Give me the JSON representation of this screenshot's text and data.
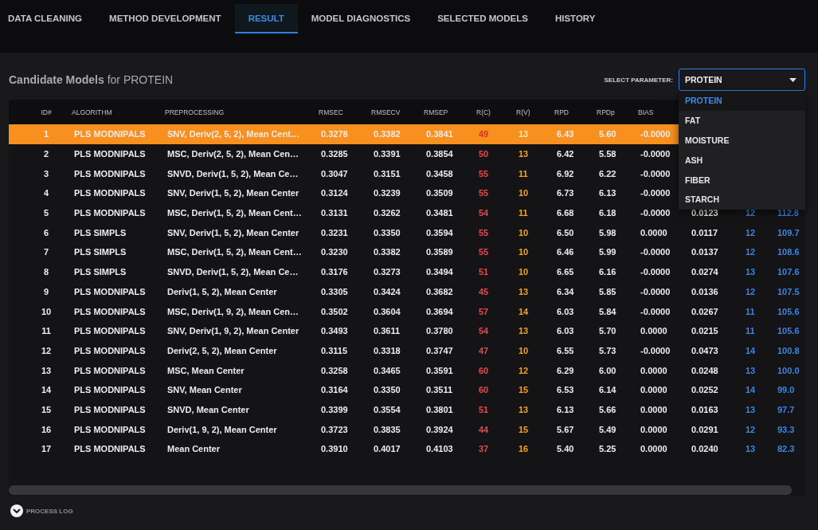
{
  "tabs": [
    {
      "label": "DATA CLEANING",
      "selected": false
    },
    {
      "label": "METHOD DEVELOPMENT",
      "selected": false
    },
    {
      "label": "RESULT",
      "selected": true
    },
    {
      "label": "MODEL DIAGNOSTICS",
      "selected": false
    },
    {
      "label": "SELECTED MODELS",
      "selected": false
    },
    {
      "label": "HISTORY",
      "selected": false
    }
  ],
  "heading": "**Candidate Models** for PROTEIN",
  "parameter_select": {
    "label": "SELECT PARAMETER:",
    "value": "PROTEIN",
    "expanded": true,
    "options": [
      {
        "label": "PROTEIN",
        "selected": true
      },
      {
        "label": "FAT",
        "selected": false
      },
      {
        "label": "MOISTURE",
        "selected": false
      },
      {
        "label": "ASH",
        "selected": false
      },
      {
        "label": "FIBER",
        "selected": false
      },
      {
        "label": "STARCH",
        "selected": false
      }
    ]
  },
  "table": {
    "columns": [
      {
        "label": "ID#",
        "kind": "index"
      },
      {
        "label": "ALGORITHM",
        "kind": "text"
      },
      {
        "label": "PREPROCESSING",
        "kind": "text"
      },
      {
        "label": "RMSEC",
        "kind": "number"
      },
      {
        "label": "RMSECV",
        "kind": "number"
      },
      {
        "label": "RMSEP",
        "kind": "number"
      },
      {
        "label": "R(C)",
        "kind": "alert"
      },
      {
        "label": "R(V)",
        "kind": "warning"
      },
      {
        "label": "RPD",
        "kind": "number"
      },
      {
        "label": "RPDp",
        "kind": "number"
      },
      {
        "label": "BIAS",
        "kind": "number"
      },
      {
        "kind": "number"
      },
      {
        "kind": "accent"
      },
      {
        "kind": "accent"
      }
    ],
    "rows": [
      {
        "selected": true,
        "cells": [
          "1",
          "PLS MODNIPALS",
          "SNV, Deriv(2, 5, 2), Mean Cent…",
          "0.3278",
          "0.3382",
          "0.3841",
          "49",
          "13",
          "6.43",
          "5.60",
          "-0.0000"
        ]
      },
      {
        "selected": false,
        "cells": [
          "2",
          "PLS MODNIPALS",
          "MSC, Deriv(2, 5, 2), Mean Cen…",
          "0.3285",
          "0.3391",
          "0.3854",
          "50",
          "13",
          "6.42",
          "5.58",
          "-0.0000"
        ]
      },
      {
        "selected": false,
        "cells": [
          "3",
          "PLS MODNIPALS",
          "SNVD, Deriv(1, 5, 2), Mean Ce…",
          "0.3047",
          "0.3151",
          "0.3458",
          "55",
          "11",
          "6.92",
          "6.22",
          "-0.0000"
        ]
      },
      {
        "selected": false,
        "cells": [
          "4",
          "PLS MODNIPALS",
          "SNV, Deriv(1, 5, 2), Mean Center",
          "0.3124",
          "0.3239",
          "0.3509",
          "55",
          "10",
          "6.73",
          "6.13",
          "-0.0000"
        ]
      },
      {
        "selected": false,
        "cells": [
          "5",
          "PLS MODNIPALS",
          "MSC, Deriv(1, 5, 2), Mean Cent…",
          "0.3131",
          "0.3262",
          "0.3481",
          "54",
          "11",
          "6.68",
          "6.18",
          "-0.0000",
          "0.0123",
          "12",
          "112.8"
        ]
      },
      {
        "selected": false,
        "cells": [
          "6",
          "PLS SIMPLS",
          "SNV, Deriv(1, 5, 2), Mean Center",
          "0.3231",
          "0.3350",
          "0.3594",
          "55",
          "10",
          "6.50",
          "5.98",
          "0.0000",
          "0.0117",
          "12",
          "109.7"
        ]
      },
      {
        "selected": false,
        "cells": [
          "7",
          "PLS SIMPLS",
          "MSC, Deriv(1, 5, 2), Mean Cent…",
          "0.3230",
          "0.3382",
          "0.3589",
          "55",
          "10",
          "6.46",
          "5.99",
          "-0.0000",
          "0.0137",
          "12",
          "108.6"
        ]
      },
      {
        "selected": false,
        "cells": [
          "8",
          "PLS SIMPLS",
          "SNVD, Deriv(1, 5, 2), Mean Ce…",
          "0.3176",
          "0.3273",
          "0.3494",
          "51",
          "10",
          "6.65",
          "6.16",
          "-0.0000",
          "0.0274",
          "13",
          "107.6"
        ]
      },
      {
        "selected": false,
        "cells": [
          "9",
          "PLS MODNIPALS",
          "Deriv(1, 5, 2), Mean Center",
          "0.3305",
          "0.3424",
          "0.3682",
          "45",
          "13",
          "6.34",
          "5.85",
          "-0.0000",
          "0.0136",
          "12",
          "107.5"
        ]
      },
      {
        "selected": false,
        "cells": [
          "10",
          "PLS MODNIPALS",
          "MSC, Deriv(1, 9, 2), Mean Cen…",
          "0.3502",
          "0.3604",
          "0.3694",
          "57",
          "14",
          "6.03",
          "5.84",
          "-0.0000",
          "0.0267",
          "11",
          "105.6"
        ]
      },
      {
        "selected": false,
        "cells": [
          "11",
          "PLS MODNIPALS",
          "SNV, Deriv(1, 9, 2), Mean Center",
          "0.3493",
          "0.3611",
          "0.3780",
          "54",
          "13",
          "6.03",
          "5.70",
          "0.0000",
          "0.0215",
          "11",
          "105.6"
        ]
      },
      {
        "selected": false,
        "cells": [
          "12",
          "PLS MODNIPALS",
          "Deriv(2, 5, 2), Mean Center",
          "0.3115",
          "0.3318",
          "0.3747",
          "47",
          "10",
          "6.55",
          "5.73",
          "-0.0000",
          "0.0473",
          "14",
          "100.8"
        ]
      },
      {
        "selected": false,
        "cells": [
          "13",
          "PLS MODNIPALS",
          "MSC, Mean Center",
          "0.3258",
          "0.3465",
          "0.3591",
          "60",
          "12",
          "6.29",
          "6.00",
          "0.0000",
          "0.0248",
          "13",
          "100.0"
        ]
      },
      {
        "selected": false,
        "cells": [
          "14",
          "PLS MODNIPALS",
          "SNV, Mean Center",
          "0.3164",
          "0.3350",
          "0.3511",
          "60",
          "15",
          "6.53",
          "6.14",
          "0.0000",
          "0.0252",
          "14",
          "99.0"
        ]
      },
      {
        "selected": false,
        "cells": [
          "15",
          "PLS MODNIPALS",
          "SNVD, Mean Center",
          "0.3399",
          "0.3554",
          "0.3801",
          "51",
          "13",
          "6.13",
          "5.66",
          "0.0000",
          "0.0163",
          "13",
          "97.7"
        ]
      },
      {
        "selected": false,
        "cells": [
          "16",
          "PLS MODNIPALS",
          "Deriv(1, 9, 2), Mean Center",
          "0.3723",
          "0.3835",
          "0.3924",
          "44",
          "15",
          "5.67",
          "5.49",
          "0.0000",
          "0.0291",
          "12",
          "93.3"
        ]
      },
      {
        "selected": false,
        "cells": [
          "17",
          "PLS MODNIPALS",
          "Mean Center",
          "0.3910",
          "0.4017",
          "0.4103",
          "37",
          "16",
          "5.40",
          "5.25",
          "0.0000",
          "0.0240",
          "13",
          "82.3"
        ]
      }
    ]
  },
  "process_log": {
    "label": "PROCESS LOG",
    "expanded": false
  }
}
